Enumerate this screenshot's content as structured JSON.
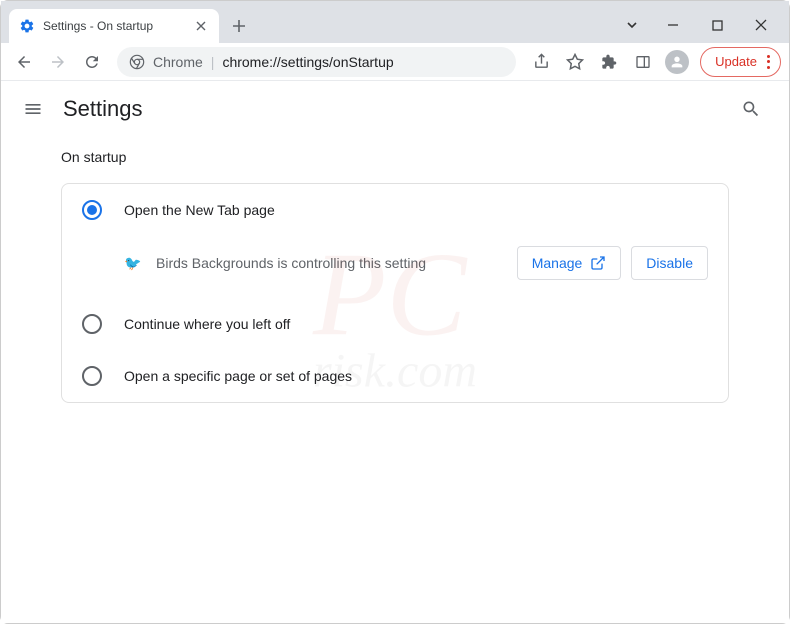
{
  "window": {
    "tab_title": "Settings - On startup"
  },
  "toolbar": {
    "omnibox_prefix": "Chrome",
    "omnibox_url": "chrome://settings/onStartup",
    "update_label": "Update"
  },
  "settings": {
    "header_title": "Settings",
    "section_title": "On startup",
    "options": [
      {
        "label": "Open the New Tab page",
        "selected": true
      },
      {
        "label": "Continue where you left off",
        "selected": false
      },
      {
        "label": "Open a specific page or set of pages",
        "selected": false
      }
    ],
    "extension_control": {
      "icon": "🐦",
      "text": "Birds Backgrounds is controlling this setting",
      "manage_label": "Manage",
      "disable_label": "Disable"
    }
  },
  "watermark": {
    "main": "PC",
    "sub": "risk.com"
  }
}
